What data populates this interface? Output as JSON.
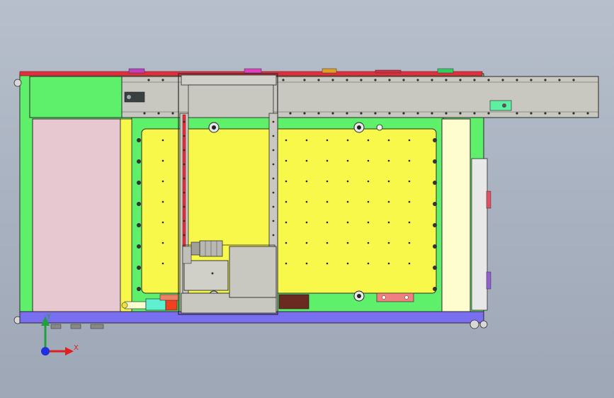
{
  "viewport": {
    "background_top": "#b7bfcc",
    "background_bottom": "#9ea7b6"
  },
  "triad": {
    "x_label": "X",
    "y_label": "Y",
    "x_color": "#e02020",
    "y_color": "#20a040",
    "z_color": "#2030e0"
  },
  "model_colors": {
    "frame_green": "#5ef06a",
    "bed_yellow": "#f8f84a",
    "panel_pink": "#e8c8d0",
    "panel_cream": "#fdfdd0",
    "rail_grey": "#c8c8c0",
    "bottom_rail": "#7a6ef0",
    "top_rail": "#e03040",
    "motor_grey": "#b8b8b0",
    "dark_block": "#6a2a20"
  },
  "colors": {
    "cabinet_green": "#5ef06a",
    "rail_tint": "#c8c8c0",
    "bottom_purple": "#7a6ef0",
    "top_red": "#e03040"
  }
}
